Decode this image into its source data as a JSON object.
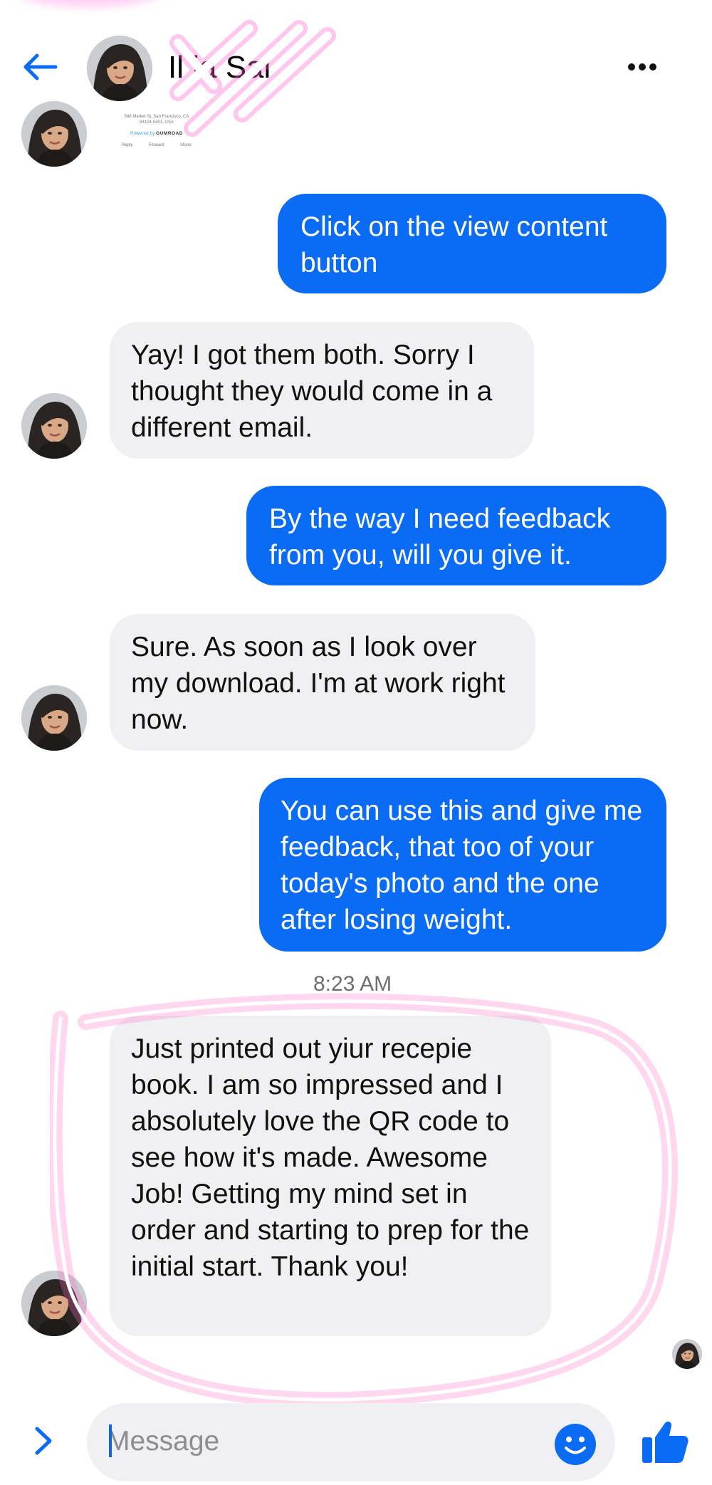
{
  "header": {
    "contact_name": "Il    ia Sai",
    "back_icon": "arrow-left-icon",
    "more_icon": "more-horizontal-icon"
  },
  "receipt": {
    "address_line1": "548 Market St, San Francisco, CA",
    "address_line2": "94104-5401, USA",
    "powered_by": "Powered by",
    "brand": "GUMROAD",
    "actions": [
      "Reply",
      "Forward",
      "Share"
    ]
  },
  "messages": [
    {
      "sender": "me",
      "text": "Click on the view content button"
    },
    {
      "sender": "contact",
      "text": "Yay! I got them both. Sorry I thought they would come in a different email."
    },
    {
      "sender": "me",
      "text": "By the way I need feedback from you, will you give it."
    },
    {
      "sender": "contact",
      "text": "Sure. As soon as I look over my download.  I'm at work right now."
    },
    {
      "sender": "me",
      "text": "You can use this and give me feedback, that too of your today's photo and the one after losing weight."
    },
    {
      "sender": "contact",
      "text": "Just printed out yiur recepie book. I am so impressed and I absolutely love the QR code to see how it's made. Awesome Job! Getting my mind set in order and starting to prep for the initial start.  Thank you!"
    }
  ],
  "timestamp": "8:23 AM",
  "composer": {
    "placeholder": "Message",
    "expand_icon": "chevron-right-icon",
    "emoji_icon": "smiley-icon",
    "like_icon": "thumbs-up-icon"
  },
  "colors": {
    "accent": "#0a6cf5",
    "outgoing_bubble": "#0a6cf5",
    "incoming_bubble": "#f0f0f2",
    "highlight": "#ff6ec7"
  }
}
